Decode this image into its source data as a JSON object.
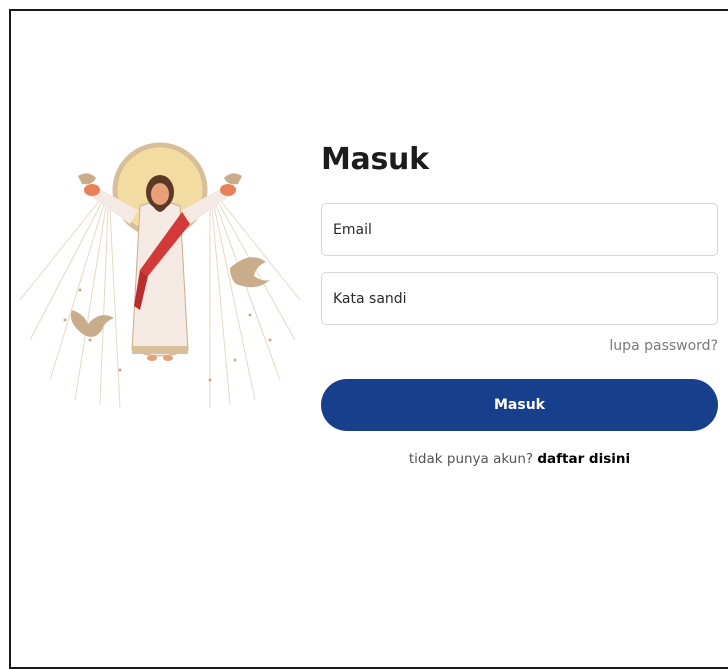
{
  "login": {
    "title": "Masuk",
    "email_placeholder": "Email",
    "password_placeholder": "Kata sandi",
    "forgot_password": "lupa password?",
    "submit_label": "Masuk",
    "no_account_text": "tidak punya akun?",
    "register_link": "daftar disini"
  },
  "colors": {
    "primary_button": "#173f8c",
    "halo": "#f3dca1",
    "robe": "#f4e9e3",
    "sash": "#d23a3a",
    "dove": "#c9ad8a"
  },
  "illustration": {
    "icon": "risen-christ-illustration"
  }
}
